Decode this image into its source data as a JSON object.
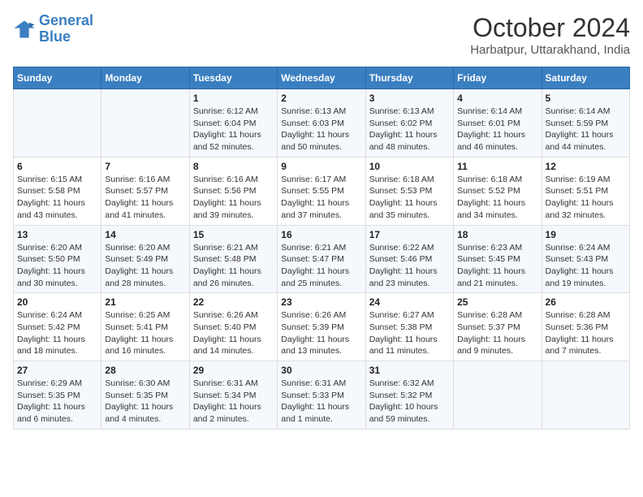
{
  "logo": {
    "line1": "General",
    "line2": "Blue"
  },
  "title": "October 2024",
  "subtitle": "Harbatpur, Uttarakhand, India",
  "days_header": [
    "Sunday",
    "Monday",
    "Tuesday",
    "Wednesday",
    "Thursday",
    "Friday",
    "Saturday"
  ],
  "weeks": [
    [
      {
        "day": "",
        "info": ""
      },
      {
        "day": "",
        "info": ""
      },
      {
        "day": "1",
        "info": "Sunrise: 6:12 AM\nSunset: 6:04 PM\nDaylight: 11 hours and 52 minutes."
      },
      {
        "day": "2",
        "info": "Sunrise: 6:13 AM\nSunset: 6:03 PM\nDaylight: 11 hours and 50 minutes."
      },
      {
        "day": "3",
        "info": "Sunrise: 6:13 AM\nSunset: 6:02 PM\nDaylight: 11 hours and 48 minutes."
      },
      {
        "day": "4",
        "info": "Sunrise: 6:14 AM\nSunset: 6:01 PM\nDaylight: 11 hours and 46 minutes."
      },
      {
        "day": "5",
        "info": "Sunrise: 6:14 AM\nSunset: 5:59 PM\nDaylight: 11 hours and 44 minutes."
      }
    ],
    [
      {
        "day": "6",
        "info": "Sunrise: 6:15 AM\nSunset: 5:58 PM\nDaylight: 11 hours and 43 minutes."
      },
      {
        "day": "7",
        "info": "Sunrise: 6:16 AM\nSunset: 5:57 PM\nDaylight: 11 hours and 41 minutes."
      },
      {
        "day": "8",
        "info": "Sunrise: 6:16 AM\nSunset: 5:56 PM\nDaylight: 11 hours and 39 minutes."
      },
      {
        "day": "9",
        "info": "Sunrise: 6:17 AM\nSunset: 5:55 PM\nDaylight: 11 hours and 37 minutes."
      },
      {
        "day": "10",
        "info": "Sunrise: 6:18 AM\nSunset: 5:53 PM\nDaylight: 11 hours and 35 minutes."
      },
      {
        "day": "11",
        "info": "Sunrise: 6:18 AM\nSunset: 5:52 PM\nDaylight: 11 hours and 34 minutes."
      },
      {
        "day": "12",
        "info": "Sunrise: 6:19 AM\nSunset: 5:51 PM\nDaylight: 11 hours and 32 minutes."
      }
    ],
    [
      {
        "day": "13",
        "info": "Sunrise: 6:20 AM\nSunset: 5:50 PM\nDaylight: 11 hours and 30 minutes."
      },
      {
        "day": "14",
        "info": "Sunrise: 6:20 AM\nSunset: 5:49 PM\nDaylight: 11 hours and 28 minutes."
      },
      {
        "day": "15",
        "info": "Sunrise: 6:21 AM\nSunset: 5:48 PM\nDaylight: 11 hours and 26 minutes."
      },
      {
        "day": "16",
        "info": "Sunrise: 6:21 AM\nSunset: 5:47 PM\nDaylight: 11 hours and 25 minutes."
      },
      {
        "day": "17",
        "info": "Sunrise: 6:22 AM\nSunset: 5:46 PM\nDaylight: 11 hours and 23 minutes."
      },
      {
        "day": "18",
        "info": "Sunrise: 6:23 AM\nSunset: 5:45 PM\nDaylight: 11 hours and 21 minutes."
      },
      {
        "day": "19",
        "info": "Sunrise: 6:24 AM\nSunset: 5:43 PM\nDaylight: 11 hours and 19 minutes."
      }
    ],
    [
      {
        "day": "20",
        "info": "Sunrise: 6:24 AM\nSunset: 5:42 PM\nDaylight: 11 hours and 18 minutes."
      },
      {
        "day": "21",
        "info": "Sunrise: 6:25 AM\nSunset: 5:41 PM\nDaylight: 11 hours and 16 minutes."
      },
      {
        "day": "22",
        "info": "Sunrise: 6:26 AM\nSunset: 5:40 PM\nDaylight: 11 hours and 14 minutes."
      },
      {
        "day": "23",
        "info": "Sunrise: 6:26 AM\nSunset: 5:39 PM\nDaylight: 11 hours and 13 minutes."
      },
      {
        "day": "24",
        "info": "Sunrise: 6:27 AM\nSunset: 5:38 PM\nDaylight: 11 hours and 11 minutes."
      },
      {
        "day": "25",
        "info": "Sunrise: 6:28 AM\nSunset: 5:37 PM\nDaylight: 11 hours and 9 minutes."
      },
      {
        "day": "26",
        "info": "Sunrise: 6:28 AM\nSunset: 5:36 PM\nDaylight: 11 hours and 7 minutes."
      }
    ],
    [
      {
        "day": "27",
        "info": "Sunrise: 6:29 AM\nSunset: 5:35 PM\nDaylight: 11 hours and 6 minutes."
      },
      {
        "day": "28",
        "info": "Sunrise: 6:30 AM\nSunset: 5:35 PM\nDaylight: 11 hours and 4 minutes."
      },
      {
        "day": "29",
        "info": "Sunrise: 6:31 AM\nSunset: 5:34 PM\nDaylight: 11 hours and 2 minutes."
      },
      {
        "day": "30",
        "info": "Sunrise: 6:31 AM\nSunset: 5:33 PM\nDaylight: 11 hours and 1 minute."
      },
      {
        "day": "31",
        "info": "Sunrise: 6:32 AM\nSunset: 5:32 PM\nDaylight: 10 hours and 59 minutes."
      },
      {
        "day": "",
        "info": ""
      },
      {
        "day": "",
        "info": ""
      }
    ]
  ]
}
